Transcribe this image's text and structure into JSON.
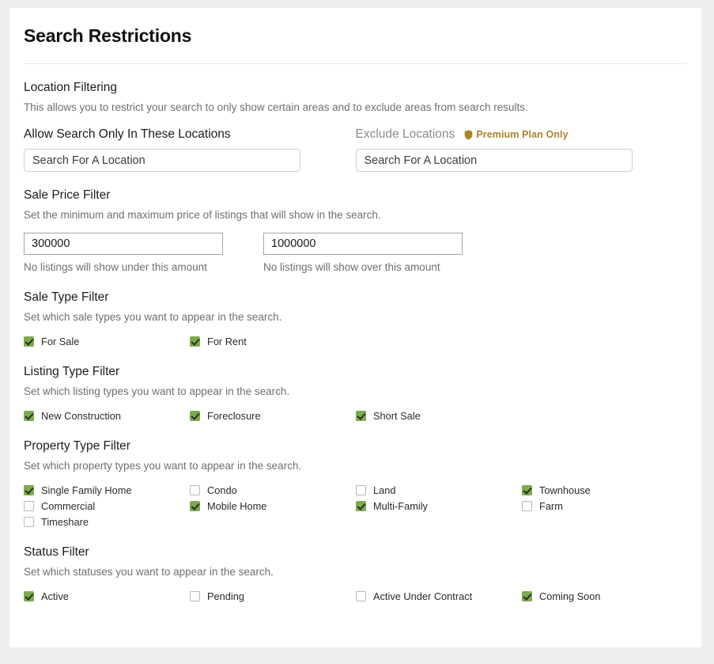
{
  "page": {
    "title": "Search Restrictions",
    "accent_green": "#7cab4d",
    "premium_color": "#a8842c",
    "background": "#eceef0",
    "card_background": "#ffffff"
  },
  "location_section": {
    "title": "Location Filtering",
    "description": "This allows you to restrict your search to only show certain areas and to exclude areas from search results.",
    "allow_label": "Allow Search Only In These Locations",
    "allow_placeholder": "Search For A Location",
    "allow_value": "",
    "exclude_label": "Exclude Locations",
    "exclude_placeholder": "Search For A Location",
    "exclude_value": "",
    "premium_badge": "Premium Plan Only",
    "premium_icon": "shield-icon"
  },
  "price_section": {
    "title": "Sale Price Filter",
    "description": "Set the minimum and maximum price of listings that will show in the search.",
    "min_value": "300000",
    "min_hint": "No listings will show under this amount",
    "max_value": "1000000",
    "max_hint": "No listings will show over this amount"
  },
  "sale_type_section": {
    "title": "Sale Type Filter",
    "description": "Set which sale types you want to appear in the search.",
    "options": [
      {
        "label": "For Sale",
        "checked": true
      },
      {
        "label": "For Rent",
        "checked": true
      }
    ]
  },
  "listing_type_section": {
    "title": "Listing Type Filter",
    "description": "Set which listing types you want to appear in the search.",
    "options": [
      {
        "label": "New Construction",
        "checked": true
      },
      {
        "label": "Foreclosure",
        "checked": true
      },
      {
        "label": "Short Sale",
        "checked": true
      }
    ]
  },
  "property_type_section": {
    "title": "Property Type Filter",
    "description": "Set which property types you want to appear in the search.",
    "options": [
      {
        "label": "Single Family Home",
        "checked": true
      },
      {
        "label": "Condo",
        "checked": false
      },
      {
        "label": "Land",
        "checked": false
      },
      {
        "label": "Townhouse",
        "checked": true
      },
      {
        "label": "Commercial",
        "checked": false
      },
      {
        "label": "Mobile Home",
        "checked": true
      },
      {
        "label": "Multi-Family",
        "checked": true
      },
      {
        "label": "Farm",
        "checked": false
      },
      {
        "label": "Timeshare",
        "checked": false
      }
    ]
  },
  "status_section": {
    "title": "Status Filter",
    "description": "Set which statuses you want to appear in the search.",
    "options": [
      {
        "label": "Active",
        "checked": true
      },
      {
        "label": "Pending",
        "checked": false
      },
      {
        "label": "Active Under Contract",
        "checked": false
      },
      {
        "label": "Coming Soon",
        "checked": true
      }
    ]
  }
}
